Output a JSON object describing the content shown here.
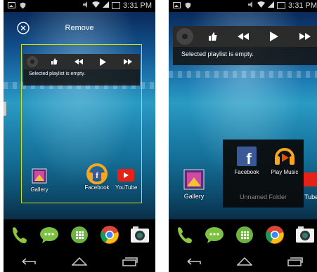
{
  "status_bar": {
    "time": "3:31 PM"
  },
  "left_screen": {
    "remove_label": "Remove",
    "widget_message": "Selected playlist is empty.",
    "apps": [
      {
        "label": "Gallery",
        "icon": "gallery-icon"
      },
      {
        "label": "Facebook",
        "icon": "facebook-icon"
      },
      {
        "label": "YouTube",
        "icon": "youtube-icon"
      }
    ]
  },
  "right_screen": {
    "widget_message": "Selected playlist is empty.",
    "gallery_label": "Gallery",
    "partial_label": "Tube",
    "folder": {
      "name": "Unnamed Folder",
      "apps": [
        {
          "label": "Facebook",
          "icon": "facebook-icon"
        },
        {
          "label": "Play Music",
          "icon": "play-music-icon"
        }
      ]
    }
  },
  "dock": [
    "phone-icon",
    "messaging-icon",
    "app-drawer-icon",
    "chrome-icon",
    "camera-icon"
  ],
  "nav_bar": [
    "back-icon",
    "home-icon",
    "recents-icon"
  ],
  "colors": {
    "accent_selection": "#d4e000",
    "youtube": "#e62117",
    "facebook": "#3b5998"
  }
}
